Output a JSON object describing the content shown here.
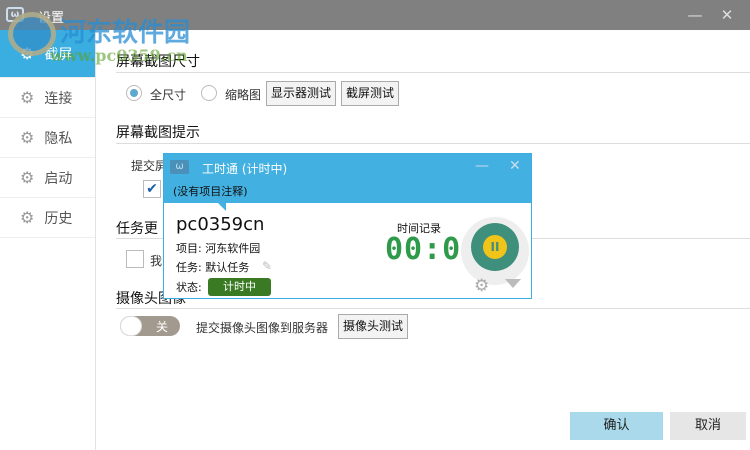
{
  "window": {
    "title": "设置",
    "logo": "ω",
    "minimize": "—",
    "close": "✕"
  },
  "sidebar": {
    "items": [
      {
        "label": "截屏",
        "icon": "gear-icon"
      },
      {
        "label": "连接",
        "icon": "gear-icon"
      },
      {
        "label": "隐私",
        "icon": "gear-icon"
      },
      {
        "label": "启动",
        "icon": "gear-icon"
      },
      {
        "label": "历史",
        "icon": "gear-icon"
      }
    ]
  },
  "screenshot_size": {
    "heading": "屏幕截图尺寸",
    "full": "全尺寸",
    "thumb": "缩略图",
    "monitor_test": "显示器测试",
    "capture_test": "截屏测试"
  },
  "screenshot_hint": {
    "heading": "屏幕截图提示",
    "submit_label": "提交屏"
  },
  "task_update": {
    "heading": "任务更",
    "option": "我"
  },
  "camera": {
    "heading": "摄像头图像",
    "toggle": "关",
    "submit_label": "提交摄像头图像到服务器",
    "test": "摄像头测试"
  },
  "footer": {
    "ok": "确认",
    "cancel": "取消"
  },
  "popup": {
    "title": "工时通 (计时中)",
    "note": "(没有项目注释)",
    "user": "pc0359cn",
    "project": "项目: 河东软件园",
    "task": "任务: 默认任务",
    "status_label": "状态:",
    "status": "计时中",
    "record_label": "时间记录",
    "timer": "00:00",
    "pause": "II",
    "minimize": "—",
    "close": "✕"
  },
  "watermark": {
    "text": "河东软件园",
    "url": "www.pc0359.cn"
  },
  "colors": {
    "accent": "#3aaee0",
    "status": "#3a7a23",
    "timer": "#2f9a4a"
  }
}
